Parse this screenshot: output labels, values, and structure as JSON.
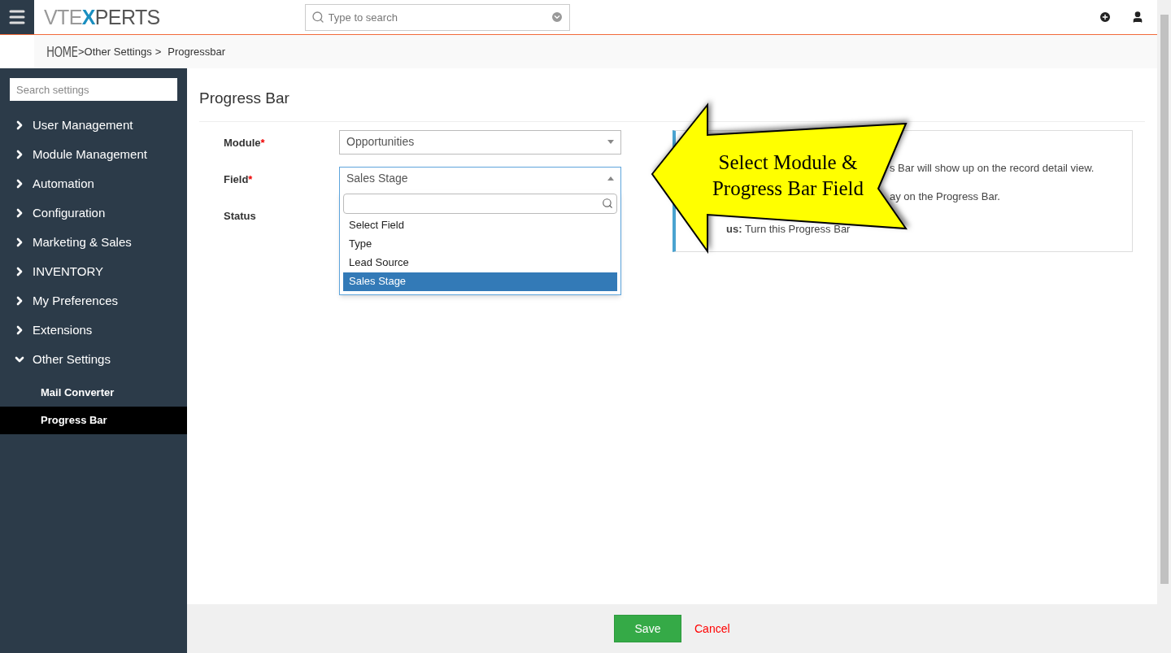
{
  "header": {
    "logo": {
      "part_1": "VTE",
      "part_2": "X",
      "part_3": "PERTS"
    },
    "search": {
      "placeholder": "Type to search"
    }
  },
  "breadcrumb": [
    {
      "label": "HOME",
      "kind": "home"
    },
    {
      "label": ">Other Settings",
      "kind": "link"
    },
    {
      "label": ">",
      "kind": "sep"
    },
    {
      "label": "Progressbar",
      "kind": "link"
    }
  ],
  "sidebar": {
    "search": {
      "placeholder": "Search settings"
    },
    "items": [
      {
        "label": "User Management",
        "expanded": false
      },
      {
        "label": "Module Management",
        "expanded": false
      },
      {
        "label": "Automation",
        "expanded": false
      },
      {
        "label": "Configuration",
        "expanded": false
      },
      {
        "label": "Marketing & Sales",
        "expanded": false
      },
      {
        "label": "INVENTORY",
        "expanded": false
      },
      {
        "label": "My Preferences",
        "expanded": false
      },
      {
        "label": "Extensions",
        "expanded": false
      },
      {
        "label": "Other Settings",
        "expanded": true,
        "children": [
          {
            "label": "Mail Converter",
            "selected": false
          },
          {
            "label": "Progress Bar",
            "selected": true
          }
        ]
      }
    ]
  },
  "page": {
    "title": "Progress Bar",
    "form": [
      {
        "label": "Module",
        "required_mark": "*",
        "value": "Opportunities",
        "open": false
      },
      {
        "label": "Field",
        "required_mark": "*",
        "value": "Sales Stage",
        "open": true,
        "options": [
          {
            "label": "Select Field",
            "selected": false
          },
          {
            "label": "Type",
            "selected": false
          },
          {
            "label": "Lead Source",
            "selected": false
          },
          {
            "label": "Sales Stage",
            "selected": true
          }
        ]
      },
      {
        "label": "Status"
      }
    ],
    "info": [
      "s Bar will show up on the record detail view.",
      "ay on the Progress Bar.",
      "**us:** Turn this Progress Bar"
    ],
    "callout": "Select Module & Progress Bar Field"
  },
  "footer": {
    "save": "Save",
    "cancel": "Cancel"
  }
}
